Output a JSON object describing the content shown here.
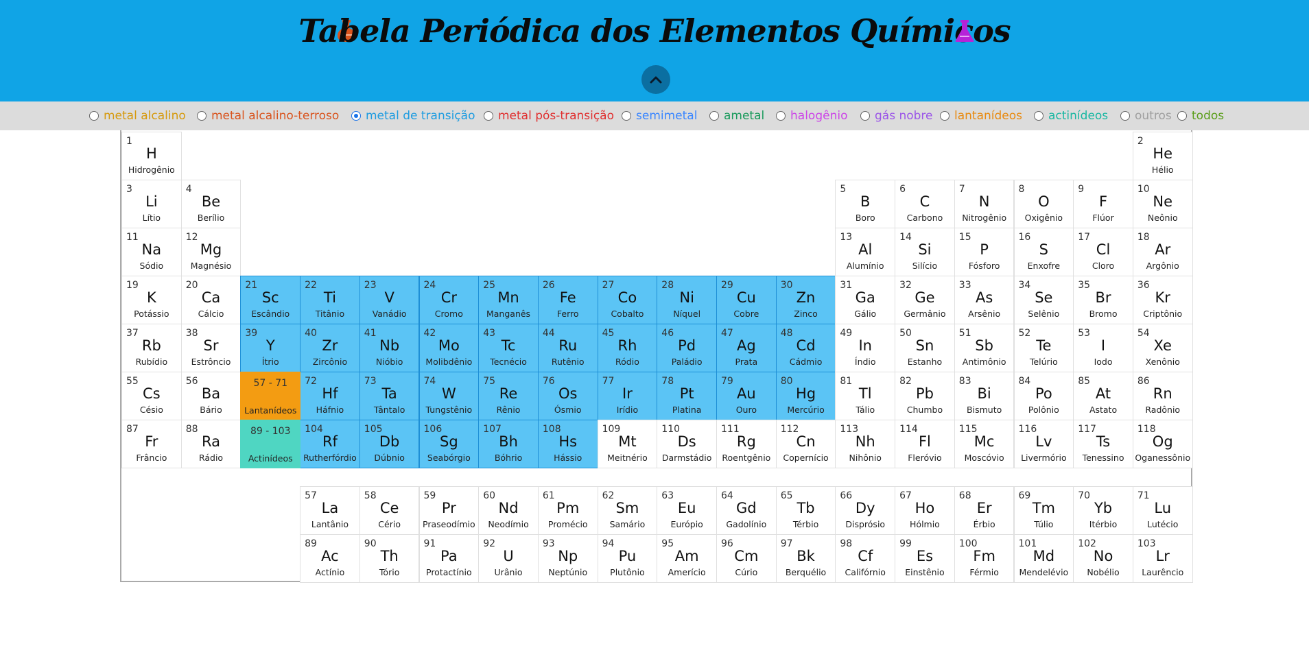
{
  "header": {
    "title": "Tabela Periódica dos Elementos Químicos",
    "bg_color": "#10a4e6",
    "flask_left": {
      "icon": "flask-icon",
      "color": "#d9541e"
    },
    "flask_right": {
      "icon": "flask-icon",
      "color": "#b624d8"
    },
    "collapse_icon": "chevron-up-icon"
  },
  "filters": [
    {
      "key": "alkali",
      "label": "metal alcalino",
      "color": "#d69a0e",
      "checked": false
    },
    {
      "key": "alkaline-earth",
      "label": "metal alcalino-terroso",
      "color": "#d9541e",
      "checked": false
    },
    {
      "key": "transition",
      "label": "metal de transição",
      "color": "#1e9ce0",
      "checked": true
    },
    {
      "key": "post-transition",
      "label": "metal pós-transição",
      "color": "#e02f2f",
      "checked": false
    },
    {
      "key": "metalloid",
      "label": "semimetal",
      "color": "#3a86ff",
      "checked": false
    },
    {
      "key": "nonmetal",
      "label": "ametal",
      "color": "#1a9a5c",
      "checked": false
    },
    {
      "key": "halogen",
      "label": "halogênio",
      "color": "#cc44e8",
      "checked": false
    },
    {
      "key": "noble-gas",
      "label": "gás nobre",
      "color": "#9b55e8",
      "checked": false
    },
    {
      "key": "lanthanide",
      "label": "lantanídeos",
      "color": "#e88a10",
      "checked": false
    },
    {
      "key": "actinide",
      "label": "actinídeos",
      "color": "#19b7a2",
      "checked": false
    },
    {
      "key": "other",
      "label": "outros",
      "color": "#a0a0a0",
      "checked": false
    },
    {
      "key": "all",
      "label": "todos",
      "color": "#5a9e1a",
      "checked": false
    }
  ],
  "elements": [
    {
      "n": 1,
      "s": "H",
      "name": "Hidrogênio",
      "col": 1,
      "row": 1
    },
    {
      "n": 2,
      "s": "He",
      "name": "Hélio",
      "col": 18,
      "row": 1
    },
    {
      "n": 3,
      "s": "Li",
      "name": "Lítio",
      "col": 1,
      "row": 2
    },
    {
      "n": 4,
      "s": "Be",
      "name": "Berílio",
      "col": 2,
      "row": 2
    },
    {
      "n": 5,
      "s": "B",
      "name": "Boro",
      "col": 13,
      "row": 2
    },
    {
      "n": 6,
      "s": "C",
      "name": "Carbono",
      "col": 14,
      "row": 2
    },
    {
      "n": 7,
      "s": "N",
      "name": "Nitrogênio",
      "col": 15,
      "row": 2
    },
    {
      "n": 8,
      "s": "O",
      "name": "Oxigênio",
      "col": 16,
      "row": 2
    },
    {
      "n": 9,
      "s": "F",
      "name": "Flúor",
      "col": 17,
      "row": 2
    },
    {
      "n": 10,
      "s": "Ne",
      "name": "Neônio",
      "col": 18,
      "row": 2
    },
    {
      "n": 11,
      "s": "Na",
      "name": "Sódio",
      "col": 1,
      "row": 3
    },
    {
      "n": 12,
      "s": "Mg",
      "name": "Magnésio",
      "col": 2,
      "row": 3
    },
    {
      "n": 13,
      "s": "Al",
      "name": "Alumínio",
      "col": 13,
      "row": 3
    },
    {
      "n": 14,
      "s": "Si",
      "name": "Silício",
      "col": 14,
      "row": 3
    },
    {
      "n": 15,
      "s": "P",
      "name": "Fósforo",
      "col": 15,
      "row": 3
    },
    {
      "n": 16,
      "s": "S",
      "name": "Enxofre",
      "col": 16,
      "row": 3
    },
    {
      "n": 17,
      "s": "Cl",
      "name": "Cloro",
      "col": 17,
      "row": 3
    },
    {
      "n": 18,
      "s": "Ar",
      "name": "Argônio",
      "col": 18,
      "row": 3
    },
    {
      "n": 19,
      "s": "K",
      "name": "Potássio",
      "col": 1,
      "row": 4
    },
    {
      "n": 20,
      "s": "Ca",
      "name": "Cálcio",
      "col": 2,
      "row": 4
    },
    {
      "n": 21,
      "s": "Sc",
      "name": "Escândio",
      "col": 3,
      "row": 4,
      "hl": true
    },
    {
      "n": 22,
      "s": "Ti",
      "name": "Titânio",
      "col": 4,
      "row": 4,
      "hl": true
    },
    {
      "n": 23,
      "s": "V",
      "name": "Vanádio",
      "col": 5,
      "row": 4,
      "hl": true
    },
    {
      "n": 24,
      "s": "Cr",
      "name": "Cromo",
      "col": 6,
      "row": 4,
      "hl": true
    },
    {
      "n": 25,
      "s": "Mn",
      "name": "Manganês",
      "col": 7,
      "row": 4,
      "hl": true
    },
    {
      "n": 26,
      "s": "Fe",
      "name": "Ferro",
      "col": 8,
      "row": 4,
      "hl": true
    },
    {
      "n": 27,
      "s": "Co",
      "name": "Cobalto",
      "col": 9,
      "row": 4,
      "hl": true
    },
    {
      "n": 28,
      "s": "Ni",
      "name": "Níquel",
      "col": 10,
      "row": 4,
      "hl": true
    },
    {
      "n": 29,
      "s": "Cu",
      "name": "Cobre",
      "col": 11,
      "row": 4,
      "hl": true
    },
    {
      "n": 30,
      "s": "Zn",
      "name": "Zinco",
      "col": 12,
      "row": 4,
      "hl": true
    },
    {
      "n": 31,
      "s": "Ga",
      "name": "Gálio",
      "col": 13,
      "row": 4
    },
    {
      "n": 32,
      "s": "Ge",
      "name": "Germânio",
      "col": 14,
      "row": 4
    },
    {
      "n": 33,
      "s": "As",
      "name": "Arsênio",
      "col": 15,
      "row": 4
    },
    {
      "n": 34,
      "s": "Se",
      "name": "Selênio",
      "col": 16,
      "row": 4
    },
    {
      "n": 35,
      "s": "Br",
      "name": "Bromo",
      "col": 17,
      "row": 4
    },
    {
      "n": 36,
      "s": "Kr",
      "name": "Criptônio",
      "col": 18,
      "row": 4
    },
    {
      "n": 37,
      "s": "Rb",
      "name": "Rubídio",
      "col": 1,
      "row": 5
    },
    {
      "n": 38,
      "s": "Sr",
      "name": "Estrôncio",
      "col": 2,
      "row": 5
    },
    {
      "n": 39,
      "s": "Y",
      "name": "Ítrio",
      "col": 3,
      "row": 5,
      "hl": true
    },
    {
      "n": 40,
      "s": "Zr",
      "name": "Zircônio",
      "col": 4,
      "row": 5,
      "hl": true
    },
    {
      "n": 41,
      "s": "Nb",
      "name": "Nióbio",
      "col": 5,
      "row": 5,
      "hl": true
    },
    {
      "n": 42,
      "s": "Mo",
      "name": "Molibdênio",
      "col": 6,
      "row": 5,
      "hl": true
    },
    {
      "n": 43,
      "s": "Tc",
      "name": "Tecnécio",
      "col": 7,
      "row": 5,
      "hl": true
    },
    {
      "n": 44,
      "s": "Ru",
      "name": "Rutênio",
      "col": 8,
      "row": 5,
      "hl": true
    },
    {
      "n": 45,
      "s": "Rh",
      "name": "Ródio",
      "col": 9,
      "row": 5,
      "hl": true
    },
    {
      "n": 46,
      "s": "Pd",
      "name": "Paládio",
      "col": 10,
      "row": 5,
      "hl": true
    },
    {
      "n": 47,
      "s": "Ag",
      "name": "Prata",
      "col": 11,
      "row": 5,
      "hl": true
    },
    {
      "n": 48,
      "s": "Cd",
      "name": "Cádmio",
      "col": 12,
      "row": 5,
      "hl": true
    },
    {
      "n": 49,
      "s": "In",
      "name": "Índio",
      "col": 13,
      "row": 5
    },
    {
      "n": 50,
      "s": "Sn",
      "name": "Estanho",
      "col": 14,
      "row": 5
    },
    {
      "n": 51,
      "s": "Sb",
      "name": "Antimônio",
      "col": 15,
      "row": 5
    },
    {
      "n": 52,
      "s": "Te",
      "name": "Telúrio",
      "col": 16,
      "row": 5
    },
    {
      "n": 53,
      "s": "I",
      "name": "Iodo",
      "col": 17,
      "row": 5
    },
    {
      "n": 54,
      "s": "Xe",
      "name": "Xenônio",
      "col": 18,
      "row": 5
    },
    {
      "n": 55,
      "s": "Cs",
      "name": "Césio",
      "col": 1,
      "row": 6
    },
    {
      "n": 56,
      "s": "Ba",
      "name": "Bário",
      "col": 2,
      "row": 6
    },
    {
      "n": 72,
      "s": "Hf",
      "name": "Háfnio",
      "col": 4,
      "row": 6,
      "hl": true
    },
    {
      "n": 73,
      "s": "Ta",
      "name": "Tântalo",
      "col": 5,
      "row": 6,
      "hl": true
    },
    {
      "n": 74,
      "s": "W",
      "name": "Tungstênio",
      "col": 6,
      "row": 6,
      "hl": true
    },
    {
      "n": 75,
      "s": "Re",
      "name": "Rênio",
      "col": 7,
      "row": 6,
      "hl": true
    },
    {
      "n": 76,
      "s": "Os",
      "name": "Ósmio",
      "col": 8,
      "row": 6,
      "hl": true
    },
    {
      "n": 77,
      "s": "Ir",
      "name": "Irídio",
      "col": 9,
      "row": 6,
      "hl": true
    },
    {
      "n": 78,
      "s": "Pt",
      "name": "Platina",
      "col": 10,
      "row": 6,
      "hl": true
    },
    {
      "n": 79,
      "s": "Au",
      "name": "Ouro",
      "col": 11,
      "row": 6,
      "hl": true
    },
    {
      "n": 80,
      "s": "Hg",
      "name": "Mercúrio",
      "col": 12,
      "row": 6,
      "hl": true
    },
    {
      "n": 81,
      "s": "Tl",
      "name": "Tálio",
      "col": 13,
      "row": 6
    },
    {
      "n": 82,
      "s": "Pb",
      "name": "Chumbo",
      "col": 14,
      "row": 6
    },
    {
      "n": 83,
      "s": "Bi",
      "name": "Bismuto",
      "col": 15,
      "row": 6
    },
    {
      "n": 84,
      "s": "Po",
      "name": "Polônio",
      "col": 16,
      "row": 6
    },
    {
      "n": 85,
      "s": "At",
      "name": "Astato",
      "col": 17,
      "row": 6
    },
    {
      "n": 86,
      "s": "Rn",
      "name": "Radônio",
      "col": 18,
      "row": 6
    },
    {
      "n": 87,
      "s": "Fr",
      "name": "Frâncio",
      "col": 1,
      "row": 7
    },
    {
      "n": 88,
      "s": "Ra",
      "name": "Rádio",
      "col": 2,
      "row": 7
    },
    {
      "n": 104,
      "s": "Rf",
      "name": "Rutherfórdio",
      "col": 4,
      "row": 7,
      "hl": true
    },
    {
      "n": 105,
      "s": "Db",
      "name": "Dúbnio",
      "col": 5,
      "row": 7,
      "hl": true
    },
    {
      "n": 106,
      "s": "Sg",
      "name": "Seabórgio",
      "col": 6,
      "row": 7,
      "hl": true
    },
    {
      "n": 107,
      "s": "Bh",
      "name": "Bóhrio",
      "col": 7,
      "row": 7,
      "hl": true
    },
    {
      "n": 108,
      "s": "Hs",
      "name": "Hássio",
      "col": 8,
      "row": 7,
      "hl": true
    },
    {
      "n": 109,
      "s": "Mt",
      "name": "Meitnério",
      "col": 9,
      "row": 7
    },
    {
      "n": 110,
      "s": "Ds",
      "name": "Darmstádio",
      "col": 10,
      "row": 7
    },
    {
      "n": 111,
      "s": "Rg",
      "name": "Roentgênio",
      "col": 11,
      "row": 7
    },
    {
      "n": 112,
      "s": "Cn",
      "name": "Copernício",
      "col": 12,
      "row": 7
    },
    {
      "n": 113,
      "s": "Nh",
      "name": "Nihônio",
      "col": 13,
      "row": 7
    },
    {
      "n": 114,
      "s": "Fl",
      "name": "Fleróvio",
      "col": 14,
      "row": 7
    },
    {
      "n": 115,
      "s": "Mc",
      "name": "Moscóvio",
      "col": 15,
      "row": 7
    },
    {
      "n": 116,
      "s": "Lv",
      "name": "Livermório",
      "col": 16,
      "row": 7
    },
    {
      "n": 117,
      "s": "Ts",
      "name": "Tenessino",
      "col": 17,
      "row": 7
    },
    {
      "n": 118,
      "s": "Og",
      "name": "Oganessônio",
      "col": 18,
      "row": 7
    },
    {
      "n": 57,
      "s": "La",
      "name": "Lantânio",
      "col": 4,
      "row": 8
    },
    {
      "n": 58,
      "s": "Ce",
      "name": "Cério",
      "col": 5,
      "row": 8
    },
    {
      "n": 59,
      "s": "Pr",
      "name": "Praseodímio",
      "col": 6,
      "row": 8
    },
    {
      "n": 60,
      "s": "Nd",
      "name": "Neodímio",
      "col": 7,
      "row": 8
    },
    {
      "n": 61,
      "s": "Pm",
      "name": "Promécio",
      "col": 8,
      "row": 8
    },
    {
      "n": 62,
      "s": "Sm",
      "name": "Samário",
      "col": 9,
      "row": 8
    },
    {
      "n": 63,
      "s": "Eu",
      "name": "Európio",
      "col": 10,
      "row": 8
    },
    {
      "n": 64,
      "s": "Gd",
      "name": "Gadolínio",
      "col": 11,
      "row": 8
    },
    {
      "n": 65,
      "s": "Tb",
      "name": "Térbio",
      "col": 12,
      "row": 8
    },
    {
      "n": 66,
      "s": "Dy",
      "name": "Disprósio",
      "col": 13,
      "row": 8
    },
    {
      "n": 67,
      "s": "Ho",
      "name": "Hólmio",
      "col": 14,
      "row": 8
    },
    {
      "n": 68,
      "s": "Er",
      "name": "Érbio",
      "col": 15,
      "row": 8
    },
    {
      "n": 69,
      "s": "Tm",
      "name": "Túlio",
      "col": 16,
      "row": 8
    },
    {
      "n": 70,
      "s": "Yb",
      "name": "Itérbio",
      "col": 17,
      "row": 8
    },
    {
      "n": 71,
      "s": "Lu",
      "name": "Lutécio",
      "col": 18,
      "row": 8
    },
    {
      "n": 89,
      "s": "Ac",
      "name": "Actínio",
      "col": 4,
      "row": 9
    },
    {
      "n": 90,
      "s": "Th",
      "name": "Tório",
      "col": 5,
      "row": 9
    },
    {
      "n": 91,
      "s": "Pa",
      "name": "Protactínio",
      "col": 6,
      "row": 9
    },
    {
      "n": 92,
      "s": "U",
      "name": "Urânio",
      "col": 7,
      "row": 9
    },
    {
      "n": 93,
      "s": "Np",
      "name": "Neptúnio",
      "col": 8,
      "row": 9
    },
    {
      "n": 94,
      "s": "Pu",
      "name": "Plutônio",
      "col": 9,
      "row": 9
    },
    {
      "n": 95,
      "s": "Am",
      "name": "Amerício",
      "col": 10,
      "row": 9
    },
    {
      "n": 96,
      "s": "Cm",
      "name": "Cúrio",
      "col": 11,
      "row": 9
    },
    {
      "n": 97,
      "s": "Bk",
      "name": "Berquélio",
      "col": 12,
      "row": 9
    },
    {
      "n": 98,
      "s": "Cf",
      "name": "Califórnio",
      "col": 13,
      "row": 9
    },
    {
      "n": 99,
      "s": "Es",
      "name": "Einstênio",
      "col": 14,
      "row": 9
    },
    {
      "n": 100,
      "s": "Fm",
      "name": "Férmio",
      "col": 15,
      "row": 9
    },
    {
      "n": 101,
      "s": "Md",
      "name": "Mendelévio",
      "col": 16,
      "row": 9
    },
    {
      "n": 102,
      "s": "No",
      "name": "Nobélio",
      "col": 17,
      "row": 9
    },
    {
      "n": 103,
      "s": "Lr",
      "name": "Laurêncio",
      "col": 18,
      "row": 9
    }
  ],
  "series_placeholders": [
    {
      "range": "57 - 71",
      "name": "Lantanídeos",
      "col": 3,
      "row": 6,
      "color": "#f39c12"
    },
    {
      "range": "89 - 103",
      "name": "Actinídeos",
      "col": 3,
      "row": 7,
      "color": "#4fd6c2"
    }
  ]
}
